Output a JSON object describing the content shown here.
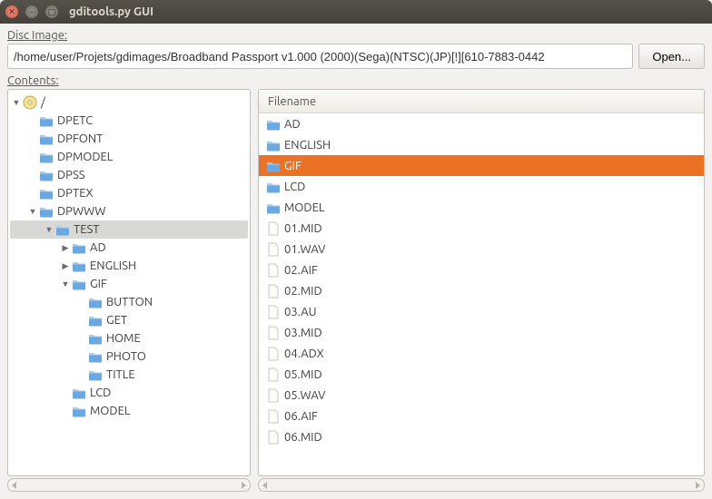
{
  "window": {
    "title": "gditools.py GUI"
  },
  "disc_image": {
    "label": "Disc Image:",
    "label_ul_char": "D",
    "path": "/home/user/Projets/gdimages/Broadband Passport v1.000 (2000)(Sega)(NTSC)(JP)[!][610-7883-0442",
    "open_label": "Open..."
  },
  "contents": {
    "label": "Contents:",
    "label_ul_char": "C"
  },
  "tree": {
    "root_label": "/",
    "nodes": [
      {
        "depth": 0,
        "expander": "down",
        "icon": "disc",
        "label": "/",
        "selected": false
      },
      {
        "depth": 1,
        "expander": "none",
        "icon": "folder",
        "label": "DPETC"
      },
      {
        "depth": 1,
        "expander": "none",
        "icon": "folder",
        "label": "DPFONT"
      },
      {
        "depth": 1,
        "expander": "none",
        "icon": "folder",
        "label": "DPMODEL"
      },
      {
        "depth": 1,
        "expander": "none",
        "icon": "folder",
        "label": "DPSS"
      },
      {
        "depth": 1,
        "expander": "none",
        "icon": "folder",
        "label": "DPTEX"
      },
      {
        "depth": 1,
        "expander": "down",
        "icon": "folder",
        "label": "DPWWW"
      },
      {
        "depth": 2,
        "expander": "down",
        "icon": "folder",
        "label": "TEST",
        "selected": true
      },
      {
        "depth": 3,
        "expander": "right",
        "icon": "folder",
        "label": "AD"
      },
      {
        "depth": 3,
        "expander": "right",
        "icon": "folder",
        "label": "ENGLISH"
      },
      {
        "depth": 3,
        "expander": "down",
        "icon": "folder",
        "label": "GIF"
      },
      {
        "depth": 4,
        "expander": "none",
        "icon": "folder",
        "label": "BUTTON"
      },
      {
        "depth": 4,
        "expander": "none",
        "icon": "folder",
        "label": "GET"
      },
      {
        "depth": 4,
        "expander": "none",
        "icon": "folder",
        "label": "HOME"
      },
      {
        "depth": 4,
        "expander": "none",
        "icon": "folder",
        "label": "PHOTO"
      },
      {
        "depth": 4,
        "expander": "none",
        "icon": "folder",
        "label": "TITLE"
      },
      {
        "depth": 3,
        "expander": "none",
        "icon": "folder",
        "label": "LCD"
      },
      {
        "depth": 3,
        "expander": "none",
        "icon": "folder",
        "label": "MODEL"
      }
    ]
  },
  "filelist": {
    "header": "Filename",
    "rows": [
      {
        "icon": "folder",
        "label": "AD"
      },
      {
        "icon": "folder",
        "label": "ENGLISH"
      },
      {
        "icon": "folder",
        "label": "GIF",
        "selected": true
      },
      {
        "icon": "folder",
        "label": "LCD"
      },
      {
        "icon": "folder",
        "label": "MODEL"
      },
      {
        "icon": "file",
        "label": "01.MID"
      },
      {
        "icon": "file",
        "label": "01.WAV"
      },
      {
        "icon": "file",
        "label": "02.AIF"
      },
      {
        "icon": "file",
        "label": "02.MID"
      },
      {
        "icon": "file",
        "label": "03.AU"
      },
      {
        "icon": "file",
        "label": "03.MID"
      },
      {
        "icon": "file",
        "label": "04.ADX"
      },
      {
        "icon": "file",
        "label": "05.MID"
      },
      {
        "icon": "file",
        "label": "05.WAV"
      },
      {
        "icon": "file",
        "label": "06.AIF"
      },
      {
        "icon": "file",
        "label": "06.MID"
      }
    ]
  }
}
